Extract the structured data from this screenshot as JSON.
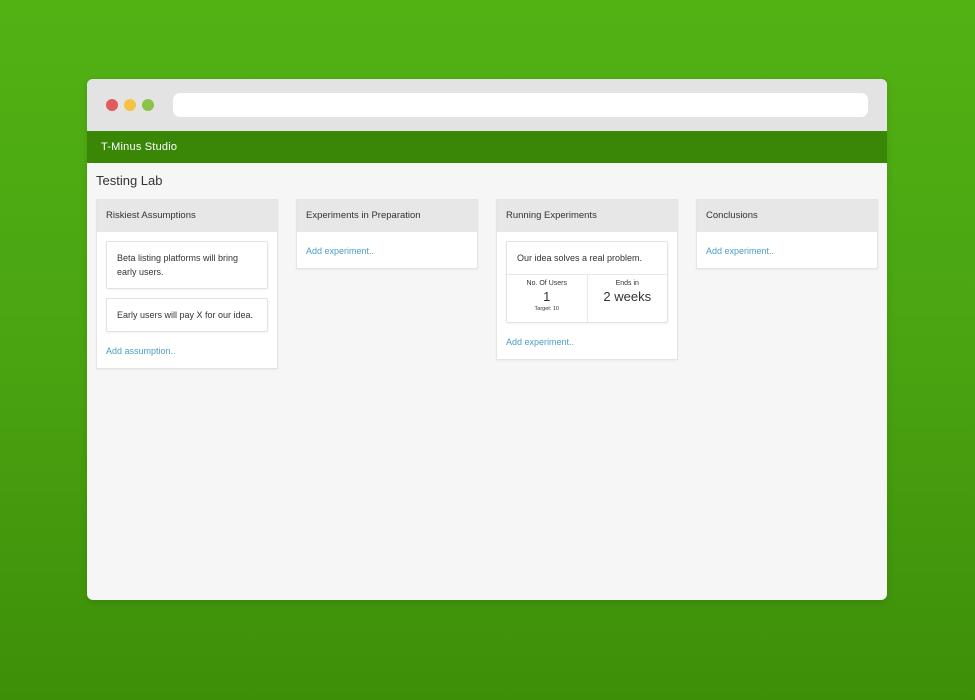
{
  "window": {
    "url": "",
    "controls": {
      "close_color": "#e05c5c",
      "minimize_color": "#f5c342",
      "maximize_color": "#8bc34a"
    }
  },
  "app": {
    "name": "T-Minus Studio",
    "bar_color": "#3a8707"
  },
  "page": {
    "title": "Testing Lab"
  },
  "columns": [
    {
      "title": "Riskiest Assumptions",
      "cards": [
        "Beta listing platforms will bring early users.",
        "Early users will pay X for our idea."
      ],
      "add_label": "Add assumption.."
    },
    {
      "title": "Experiments in Preparation",
      "add_label": "Add experiment.."
    },
    {
      "title": "Running Experiments",
      "experiment": {
        "title": "Our idea solves a real problem.",
        "users_label": "No. Of Users",
        "users_value": "1",
        "users_target": "Target: 10",
        "ends_label": "Ends in",
        "ends_value": "2 weeks"
      },
      "add_label": "Add experiment.."
    },
    {
      "title": "Conclusions",
      "add_label": "Add experiment.."
    }
  ],
  "colors": {
    "link": "#4a9fc5",
    "background_green": "#4aa411"
  }
}
